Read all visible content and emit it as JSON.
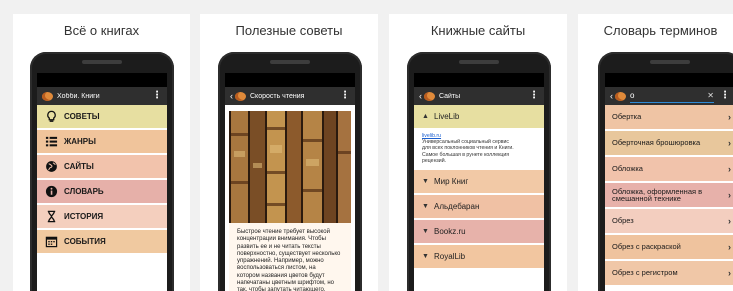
{
  "colors": {
    "salmon": "#f2c3a5",
    "tan": "#e8c998",
    "pink": "#e8b0a8",
    "sand": "#f5d6b4",
    "toolbar": "#2f2f2f"
  },
  "panel1": {
    "caption": "Всё о книгах",
    "app_title": "Хобби. Книги",
    "menu": [
      {
        "label": "СОВЕТЫ",
        "icon": "lightbulb-icon",
        "color": "#e7dfa1"
      },
      {
        "label": "ЖАНРЫ",
        "icon": "list-icon",
        "color": "#f0c49b"
      },
      {
        "label": "САЙТЫ",
        "icon": "globe-icon",
        "color": "#f2c3ac"
      },
      {
        "label": "СЛОВАРЬ",
        "icon": "info-icon",
        "color": "#e6b0a9"
      },
      {
        "label": "ИСТОРИЯ",
        "icon": "hourglass-icon",
        "color": "#f4cfbe"
      },
      {
        "label": "СОБЫТИЯ",
        "icon": "calendar-icon",
        "color": "#f0c9a0"
      }
    ]
  },
  "panel2": {
    "caption": "Полезные советы",
    "app_title": "Скорость чтения",
    "article_lines": [
      "Быстрое чтение требует высокой",
      "концентрации внимания. Чтобы",
      "развить ее и не читать тексты",
      "поверхностно, существует несколько",
      "упражнений. Например, можно",
      "воспользоваться листом, на",
      "котором названия цветов будут",
      "напечатаны цветным шрифтом, но",
      "так, чтобы запутать читающего."
    ]
  },
  "panel3": {
    "caption": "Книжные сайты",
    "app_title": "Сайты",
    "expanded": {
      "label": "LiveLib",
      "link": "livelib.ru",
      "desc_lines": [
        "Универсальный социальный сервис",
        "для всех поклонников чтения и Книги.",
        "Самое большая в рунете коллекция",
        "рецензий."
      ]
    },
    "sites": [
      {
        "label": "Мир Книг",
        "color": "#f2c9a6"
      },
      {
        "label": "Альдебаран",
        "color": "#f0c1a4"
      },
      {
        "label": "Bookz.ru",
        "color": "#e7b2aa"
      },
      {
        "label": "RoyalLib",
        "color": "#f2c6a0"
      }
    ]
  },
  "panel4": {
    "caption": "Словарь терминов",
    "search_value": "о",
    "terms": [
      {
        "label": "Обертка",
        "color": "#efc4a4"
      },
      {
        "label": "Оберточная брошюровка",
        "color": "#e8c79c"
      },
      {
        "label": "Обложка",
        "color": "#f1c3ab"
      },
      {
        "label": "Обложка, оформленная в смешанной технике",
        "color": "#e7b1aa"
      },
      {
        "label": "Обрез",
        "color": "#f3cebf"
      },
      {
        "label": "Обрез с раскраской",
        "color": "#efc39e"
      },
      {
        "label": "Обрез с регистром",
        "color": "#f0c7a7"
      }
    ]
  }
}
